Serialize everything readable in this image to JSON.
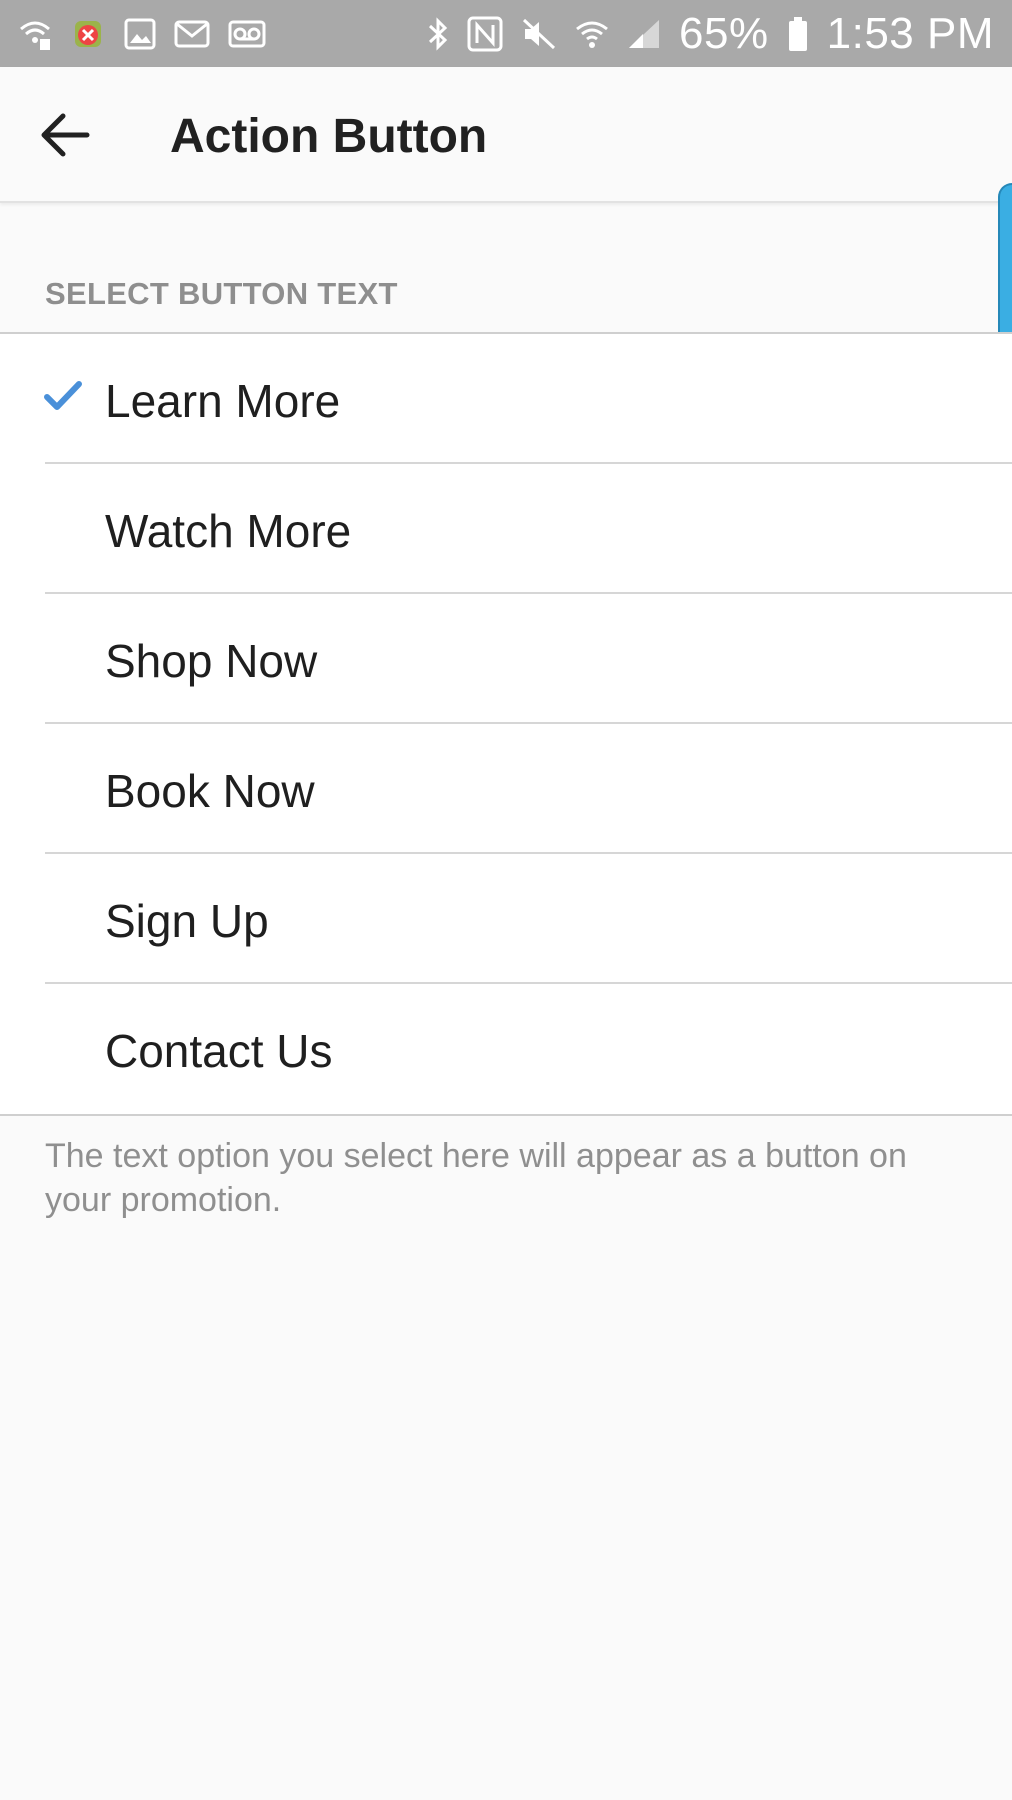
{
  "status_bar": {
    "icons_left": [
      "wifi-icon",
      "android-debug-icon",
      "image-icon",
      "gmail-icon",
      "voicemail-icon"
    ],
    "icons_right": [
      "bluetooth-icon",
      "nfc-icon",
      "mute-icon",
      "wifi-signal-icon",
      "cell-signal-icon"
    ],
    "battery_percent": "65%",
    "time": "1:53 PM"
  },
  "app_bar": {
    "back_icon": "back-arrow-icon",
    "title": "Action Button"
  },
  "section": {
    "header": "SELECT BUTTON TEXT"
  },
  "options": [
    {
      "label": "Learn More",
      "selected": true
    },
    {
      "label": "Watch More",
      "selected": false
    },
    {
      "label": "Shop Now",
      "selected": false
    },
    {
      "label": "Book Now",
      "selected": false
    },
    {
      "label": "Sign Up",
      "selected": false
    },
    {
      "label": "Contact Us",
      "selected": false
    }
  ],
  "footer_note": "The text option you select here will appear as a button on your promotion.",
  "colors": {
    "status_bar": "#a9a9a9",
    "check": "#4a90d9",
    "edge_panel": "#3aaee3"
  }
}
